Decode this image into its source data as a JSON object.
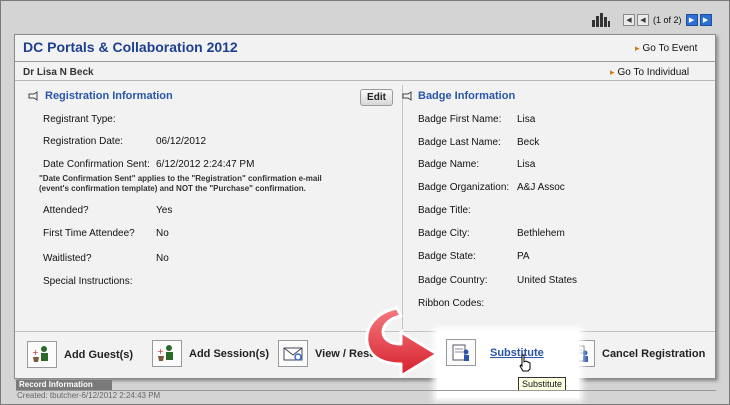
{
  "pager": {
    "text": "(1 of 2)"
  },
  "header": {
    "title": "DC Portals & Collaboration 2012",
    "go_to_event": "Go To Event",
    "person": "Dr Lisa N Beck",
    "go_to_individual": "Go To Individual"
  },
  "registration": {
    "heading": "Registration Information",
    "edit_label": "Edit",
    "registrant_type_label": "Registrant Type:",
    "registration_date_label": "Registration Date:",
    "registration_date_value": "06/12/2012",
    "date_conf_label": "Date Confirmation Sent:",
    "date_conf_value": "6/12/2012 2:24:47 PM",
    "note_line1": "\"Date Confirmation Sent\" applies to the \"Registration\" confirmation e-mail",
    "note_line2": "(event's confirmation template) and NOT the \"Purchase\" confirmation.",
    "attended_label": "Attended?",
    "attended_value": "Yes",
    "first_time_label": "First Time Attendee?",
    "first_time_value": "No",
    "waitlisted_label": "Waitlisted?",
    "waitlisted_value": "No",
    "special_instructions_label": "Special Instructions:"
  },
  "badge": {
    "heading": "Badge Information",
    "first_name_label": "Badge First Name:",
    "first_name_value": "Lisa",
    "last_name_label": "Badge Last Name:",
    "last_name_value": "Beck",
    "name_label": "Badge Name:",
    "name_value": "Lisa",
    "org_label": "Badge Organization:",
    "org_value": "A&J Assoc",
    "title_label": "Badge Title:",
    "city_label": "Badge City:",
    "city_value": "Bethlehem",
    "state_label": "Badge State:",
    "state_value": "PA",
    "country_label": "Badge Country:",
    "country_value": "United States",
    "ribbon_label": "Ribbon Codes:"
  },
  "actions": {
    "add_guests": "Add Guest(s)",
    "add_sessions": "Add Session(s)",
    "view_resend": "View / Resen",
    "substitute": "Substitute",
    "cancel_registration": "Cancel Registration"
  },
  "tooltip": "Substitute",
  "footer": {
    "heading": "Record Information",
    "created": "Created: tbutcher-6/12/2012 2:24:43 PM"
  },
  "colors": {
    "title": "#1f3f8f",
    "link": "#2a55a8",
    "arrow": "#e8303a",
    "pager_active": "#2d6fd2"
  }
}
